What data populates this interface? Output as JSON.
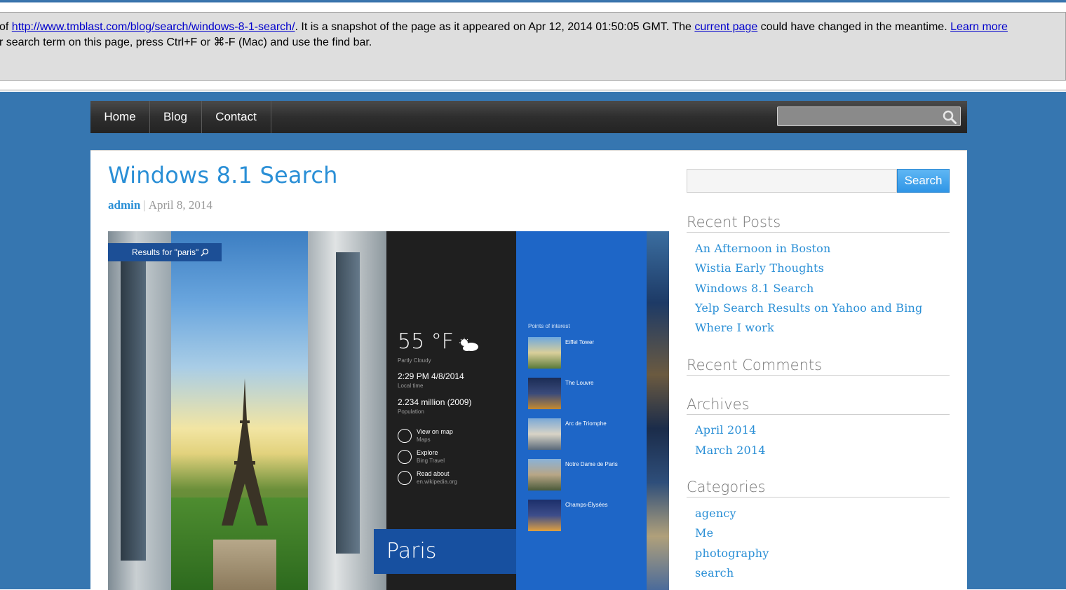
{
  "cache_banner": {
    "line1_prefix": "of ",
    "cached_url": "http://www.tmblast.com/blog/search/windows-8-1-search/",
    "line1_mid": ". It is a snapshot of the page as it appeared on Apr 12, 2014 01:50:05 GMT. The ",
    "current_page_link": "current page",
    "line1_suffix": " could have changed in the meantime. ",
    "learn_more_link": "Learn more",
    "line2": "r search term on this page, press Ctrl+F or ⌘-F (Mac) and use the find bar."
  },
  "nav": {
    "items": [
      "Home",
      "Blog",
      "Contact"
    ],
    "search_placeholder": ""
  },
  "post": {
    "title": "Windows 8.1 Search",
    "author": "admin",
    "separator": "|",
    "date": "April 8, 2014"
  },
  "screenshot": {
    "results_label": "Results for \"paris\"",
    "temperature": "55 °F",
    "condition": "Partly Cloudy",
    "local_time": "2:29 PM 4/8/2014",
    "local_time_label": "Local time",
    "population": "2.234 million (2009)",
    "population_label": "Population",
    "actions": [
      {
        "title": "View on map",
        "sub": "Maps"
      },
      {
        "title": "Explore",
        "sub": "Bing Travel"
      },
      {
        "title": "Read about",
        "sub": "en.wikipedia.org"
      }
    ],
    "city": "Paris",
    "poi_heading": "Points of interest",
    "poi": [
      "Eiffel Tower",
      "The Louvre",
      "Arc de Triomphe",
      "Notre Dame de Paris",
      "Champs-Élysées"
    ]
  },
  "sidebar": {
    "search_button": "Search",
    "search_placeholder": "",
    "recent_posts_title": "Recent Posts",
    "recent_posts": [
      "An Afternoon in Boston",
      "Wistia Early Thoughts",
      "Windows 8.1 Search",
      "Yelp Search Results on Yahoo and Bing",
      "Where I work"
    ],
    "recent_comments_title": "Recent Comments",
    "archives_title": "Archives",
    "archives": [
      "April 2014",
      "March 2014"
    ],
    "categories_title": "Categories",
    "categories": [
      "agency",
      "Me",
      "photography",
      "search"
    ]
  },
  "colors": {
    "page_background": "#3676b0",
    "link_blue": "#2a8fd6",
    "nav_dark": "#2e2e2e",
    "tile_blue": "#1e66c7"
  }
}
